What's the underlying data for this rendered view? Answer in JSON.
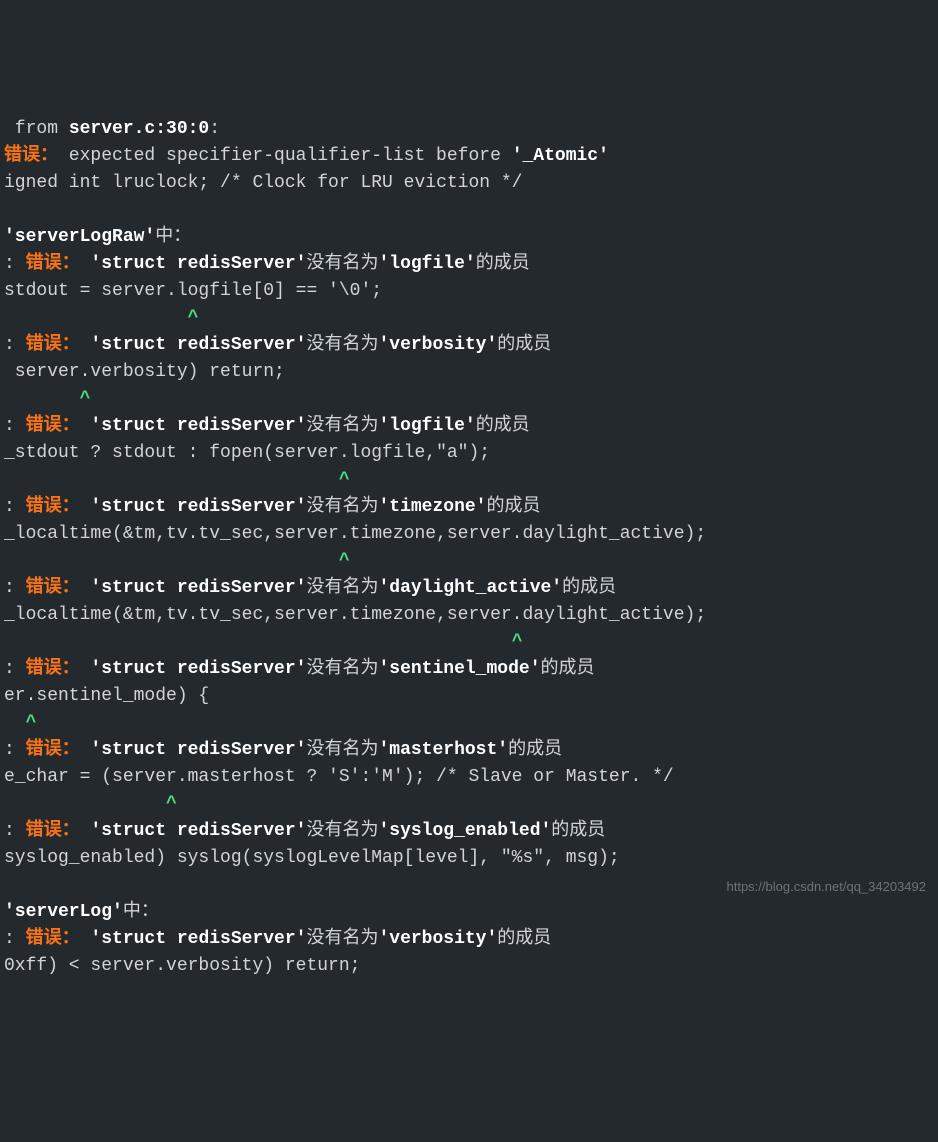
{
  "lines": [
    {
      "segments": [
        {
          "t": " from "
        },
        {
          "t": "server.c:30:0",
          "c": "bold"
        },
        {
          "t": ":"
        }
      ]
    },
    {
      "segments": [
        {
          "t": "错误：",
          "c": "err"
        },
        {
          "t": " expected specifier-qualifier-list before "
        },
        {
          "t": "'_Atomic'",
          "c": "bold"
        }
      ]
    },
    {
      "segments": [
        {
          "t": "igned int lruclock; /* Clock for LRU eviction */"
        }
      ]
    },
    {
      "segments": [
        {
          "t": " "
        }
      ]
    },
    {
      "segments": [
        {
          "t": "'serverLogRaw'",
          "c": "bold"
        },
        {
          "t": "中："
        }
      ]
    },
    {
      "segments": [
        {
          "t": ": "
        },
        {
          "t": "错误：",
          "c": "err"
        },
        {
          "t": " "
        },
        {
          "t": "'struct redisServer'",
          "c": "bold"
        },
        {
          "t": "没有名为"
        },
        {
          "t": "'logfile'",
          "c": "bold"
        },
        {
          "t": "的成员"
        }
      ]
    },
    {
      "segments": [
        {
          "t": "stdout = server.logfile[0] == '\\0';"
        }
      ]
    },
    {
      "segments": [
        {
          "t": "                 "
        },
        {
          "t": "^",
          "c": "caret"
        }
      ]
    },
    {
      "segments": [
        {
          "t": ": "
        },
        {
          "t": "错误：",
          "c": "err"
        },
        {
          "t": " "
        },
        {
          "t": "'struct redisServer'",
          "c": "bold"
        },
        {
          "t": "没有名为"
        },
        {
          "t": "'verbosity'",
          "c": "bold"
        },
        {
          "t": "的成员"
        }
      ]
    },
    {
      "segments": [
        {
          "t": " server.verbosity) return;"
        }
      ]
    },
    {
      "segments": [
        {
          "t": "       "
        },
        {
          "t": "^",
          "c": "caret"
        }
      ]
    },
    {
      "segments": [
        {
          "t": ": "
        },
        {
          "t": "错误：",
          "c": "err"
        },
        {
          "t": " "
        },
        {
          "t": "'struct redisServer'",
          "c": "bold"
        },
        {
          "t": "没有名为"
        },
        {
          "t": "'logfile'",
          "c": "bold"
        },
        {
          "t": "的成员"
        }
      ]
    },
    {
      "segments": [
        {
          "t": "_stdout ? stdout : fopen(server.logfile,\"a\");"
        }
      ]
    },
    {
      "segments": [
        {
          "t": "                               "
        },
        {
          "t": "^",
          "c": "caret"
        }
      ]
    },
    {
      "segments": [
        {
          "t": ": "
        },
        {
          "t": "错误：",
          "c": "err"
        },
        {
          "t": " "
        },
        {
          "t": "'struct redisServer'",
          "c": "bold"
        },
        {
          "t": "没有名为"
        },
        {
          "t": "'timezone'",
          "c": "bold"
        },
        {
          "t": "的成员"
        }
      ]
    },
    {
      "segments": [
        {
          "t": "_localtime(&tm,tv.tv_sec,server.timezone,server.daylight_active);"
        }
      ]
    },
    {
      "segments": [
        {
          "t": "                               "
        },
        {
          "t": "^",
          "c": "caret"
        }
      ]
    },
    {
      "segments": [
        {
          "t": ": "
        },
        {
          "t": "错误：",
          "c": "err"
        },
        {
          "t": " "
        },
        {
          "t": "'struct redisServer'",
          "c": "bold"
        },
        {
          "t": "没有名为"
        },
        {
          "t": "'daylight_active'",
          "c": "bold"
        },
        {
          "t": "的成员"
        }
      ]
    },
    {
      "segments": [
        {
          "t": "_localtime(&tm,tv.tv_sec,server.timezone,server.daylight_active);"
        }
      ]
    },
    {
      "segments": [
        {
          "t": "                                               "
        },
        {
          "t": "^",
          "c": "caret"
        }
      ]
    },
    {
      "segments": [
        {
          "t": ": "
        },
        {
          "t": "错误：",
          "c": "err"
        },
        {
          "t": " "
        },
        {
          "t": "'struct redisServer'",
          "c": "bold"
        },
        {
          "t": "没有名为"
        },
        {
          "t": "'sentinel_mode'",
          "c": "bold"
        },
        {
          "t": "的成员"
        }
      ]
    },
    {
      "segments": [
        {
          "t": "er.sentinel_mode) {"
        }
      ]
    },
    {
      "segments": [
        {
          "t": "  "
        },
        {
          "t": "^",
          "c": "caret"
        }
      ]
    },
    {
      "segments": [
        {
          "t": ": "
        },
        {
          "t": "错误：",
          "c": "err"
        },
        {
          "t": " "
        },
        {
          "t": "'struct redisServer'",
          "c": "bold"
        },
        {
          "t": "没有名为"
        },
        {
          "t": "'masterhost'",
          "c": "bold"
        },
        {
          "t": "的成员"
        }
      ]
    },
    {
      "segments": [
        {
          "t": "e_char = (server.masterhost ? 'S':'M'); /* Slave or Master. */"
        }
      ]
    },
    {
      "segments": [
        {
          "t": "               "
        },
        {
          "t": "^",
          "c": "caret"
        }
      ]
    },
    {
      "segments": [
        {
          "t": ": "
        },
        {
          "t": "错误：",
          "c": "err"
        },
        {
          "t": " "
        },
        {
          "t": "'struct redisServer'",
          "c": "bold"
        },
        {
          "t": "没有名为"
        },
        {
          "t": "'syslog_enabled'",
          "c": "bold"
        },
        {
          "t": "的成员"
        }
      ]
    },
    {
      "segments": [
        {
          "t": "syslog_enabled) syslog(syslogLevelMap[level], \"%s\", msg);"
        }
      ]
    },
    {
      "segments": [
        {
          "t": " "
        }
      ]
    },
    {
      "segments": [
        {
          "t": "'serverLog'",
          "c": "bold"
        },
        {
          "t": "中："
        }
      ]
    },
    {
      "segments": [
        {
          "t": ": "
        },
        {
          "t": "错误：",
          "c": "err"
        },
        {
          "t": " "
        },
        {
          "t": "'struct redisServer'",
          "c": "bold"
        },
        {
          "t": "没有名为"
        },
        {
          "t": "'verbosity'",
          "c": "bold"
        },
        {
          "t": "的成员"
        }
      ]
    },
    {
      "segments": [
        {
          "t": "0xff) < server.verbosity) return;"
        }
      ]
    }
  ],
  "watermark": "https://blog.csdn.net/qq_34203492"
}
